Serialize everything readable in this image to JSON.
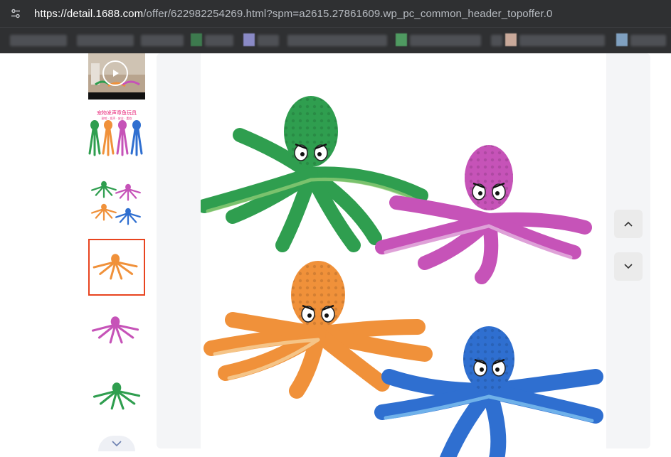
{
  "browser": {
    "url_host": "https://detail.1688.com",
    "url_rest": "/offer/622982254269.html?spm=a2615.27861609.wp_pc_common_header_topoffer.0",
    "site_info_icon": "tune-icon"
  },
  "gallery": {
    "thumbnails": [
      {
        "type": "video",
        "selected": false
      },
      {
        "type": "image",
        "selected": false,
        "caption": "宠物发声章鱼玩具",
        "subcaption": "耐咬 · 发声 · 安全 · 柔软"
      },
      {
        "type": "image",
        "selected": false
      },
      {
        "type": "image",
        "selected": true
      },
      {
        "type": "image",
        "selected": false
      },
      {
        "type": "image",
        "selected": false
      }
    ],
    "scroll_down_icon": "chevron-down-icon",
    "prev_icon": "chevron-up-icon",
    "next_icon": "chevron-down-icon"
  },
  "colors": {
    "selected_border": "#e8441f",
    "green": "#2f9e4f",
    "pink": "#c653b8",
    "orange": "#f0913a",
    "blue": "#2f6fd0"
  }
}
